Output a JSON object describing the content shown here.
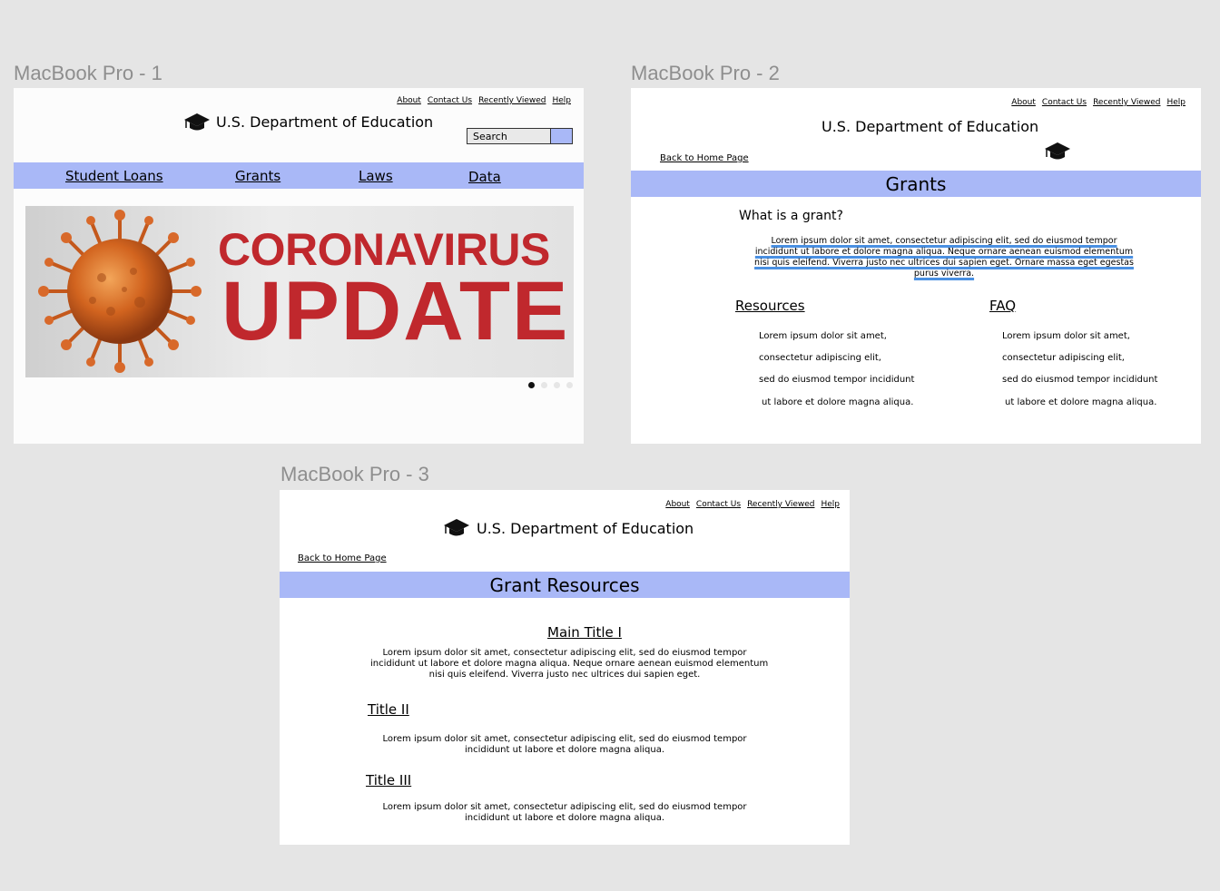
{
  "frames": {
    "f1": {
      "label": "MacBook Pro - 1"
    },
    "f2": {
      "label": "MacBook Pro - 2"
    },
    "f3": {
      "label": "MacBook Pro - 3"
    }
  },
  "common": {
    "org_title": "U.S. Department of Education",
    "links": [
      "About",
      "Contact Us",
      "Recently Viewed",
      "Help"
    ],
    "back_link": "Back to Home Page"
  },
  "home": {
    "search_placeholder": "Search",
    "nav": [
      "Student Loans",
      "Grants",
      "Laws",
      "Data"
    ],
    "banner": {
      "line1": "CORONAVIRUS",
      "line2": "UPDATE"
    },
    "carousel": {
      "count": 4,
      "active": 1
    }
  },
  "grants": {
    "page_title": "Grants",
    "question": "What is a grant?",
    "answer_lines": [
      "Lorem ipsum dolor sit amet, consectetur adipiscing elit, sed do eiusmod tempor",
      "incididunt ut labore et dolore magna aliqua. Neque ornare aenean euismod elementum",
      "nisi quis eleifend. Viverra justo nec ultrices dui sapien eget. Ornare massa eget egestas",
      "purus viverra."
    ],
    "resources_title": "Resources",
    "faq_title": "FAQ",
    "list_lines": [
      "Lorem ipsum dolor sit amet,",
      "consectetur adipiscing elit,",
      "sed do eiusmod tempor incididunt",
      "ut labore et dolore magna aliqua."
    ]
  },
  "resources": {
    "page_title": "Grant Resources",
    "sections": [
      {
        "title": "Main Title I",
        "lines": [
          "Lorem ipsum dolor sit amet, consectetur adipiscing elit, sed do eiusmod tempor",
          "incididunt ut labore et dolore magna aliqua. Neque ornare aenean euismod elementum",
          "nisi quis eleifend. Viverra justo nec ultrices dui sapien eget."
        ]
      },
      {
        "title": "Title II",
        "lines": [
          "Lorem ipsum dolor sit amet, consectetur adipiscing elit, sed do eiusmod tempor",
          "incididunt ut labore et dolore magna aliqua."
        ]
      },
      {
        "title": "Title III",
        "lines": [
          "Lorem ipsum dolor sit amet, consectetur adipiscing elit, sed do eiusmod tempor",
          "incididunt ut labore et dolore magna aliqua."
        ]
      }
    ]
  },
  "colors": {
    "accent_bar": "#a9b8f7",
    "canvas": "#e5e5e5",
    "frame_label": "#8e8e8e",
    "highlight": "#4a90e2",
    "banner_red": "#c0282d"
  }
}
